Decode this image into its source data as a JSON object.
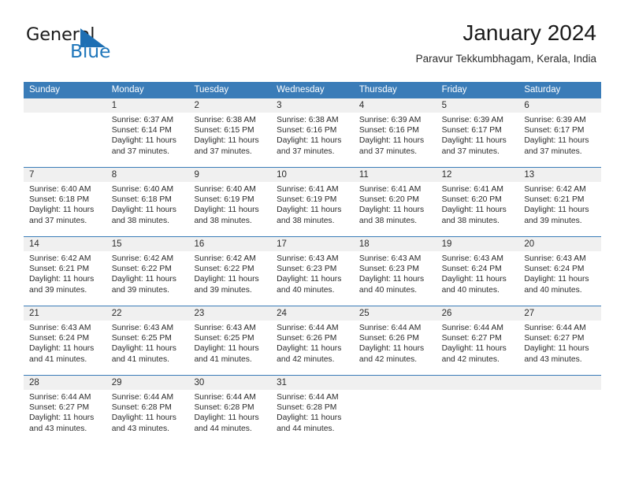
{
  "logo": {
    "word_one": "General",
    "word_two": "Blue",
    "triangle_icon": "triangle-icon",
    "blue_hex": "#2077BB"
  },
  "header": {
    "title": "January 2024",
    "subtitle": "Paravur Tekkumbhagam, Kerala, India"
  },
  "theme": {
    "header_blue": "#3A7CB8",
    "daynum_band": "#F0F0F0",
    "text": "#2B2B2B"
  },
  "calendar": {
    "weekdays": [
      "Sunday",
      "Monday",
      "Tuesday",
      "Wednesday",
      "Thursday",
      "Friday",
      "Saturday"
    ],
    "weeks": [
      [
        {
          "day": "",
          "sunrise": "",
          "sunset": "",
          "daylight1": "",
          "daylight2": ""
        },
        {
          "day": "1",
          "sunrise": "Sunrise: 6:37 AM",
          "sunset": "Sunset: 6:14 PM",
          "daylight1": "Daylight: 11 hours",
          "daylight2": "and 37 minutes."
        },
        {
          "day": "2",
          "sunrise": "Sunrise: 6:38 AM",
          "sunset": "Sunset: 6:15 PM",
          "daylight1": "Daylight: 11 hours",
          "daylight2": "and 37 minutes."
        },
        {
          "day": "3",
          "sunrise": "Sunrise: 6:38 AM",
          "sunset": "Sunset: 6:16 PM",
          "daylight1": "Daylight: 11 hours",
          "daylight2": "and 37 minutes."
        },
        {
          "day": "4",
          "sunrise": "Sunrise: 6:39 AM",
          "sunset": "Sunset: 6:16 PM",
          "daylight1": "Daylight: 11 hours",
          "daylight2": "and 37 minutes."
        },
        {
          "day": "5",
          "sunrise": "Sunrise: 6:39 AM",
          "sunset": "Sunset: 6:17 PM",
          "daylight1": "Daylight: 11 hours",
          "daylight2": "and 37 minutes."
        },
        {
          "day": "6",
          "sunrise": "Sunrise: 6:39 AM",
          "sunset": "Sunset: 6:17 PM",
          "daylight1": "Daylight: 11 hours",
          "daylight2": "and 37 minutes."
        }
      ],
      [
        {
          "day": "7",
          "sunrise": "Sunrise: 6:40 AM",
          "sunset": "Sunset: 6:18 PM",
          "daylight1": "Daylight: 11 hours",
          "daylight2": "and 37 minutes."
        },
        {
          "day": "8",
          "sunrise": "Sunrise: 6:40 AM",
          "sunset": "Sunset: 6:18 PM",
          "daylight1": "Daylight: 11 hours",
          "daylight2": "and 38 minutes."
        },
        {
          "day": "9",
          "sunrise": "Sunrise: 6:40 AM",
          "sunset": "Sunset: 6:19 PM",
          "daylight1": "Daylight: 11 hours",
          "daylight2": "and 38 minutes."
        },
        {
          "day": "10",
          "sunrise": "Sunrise: 6:41 AM",
          "sunset": "Sunset: 6:19 PM",
          "daylight1": "Daylight: 11 hours",
          "daylight2": "and 38 minutes."
        },
        {
          "day": "11",
          "sunrise": "Sunrise: 6:41 AM",
          "sunset": "Sunset: 6:20 PM",
          "daylight1": "Daylight: 11 hours",
          "daylight2": "and 38 minutes."
        },
        {
          "day": "12",
          "sunrise": "Sunrise: 6:41 AM",
          "sunset": "Sunset: 6:20 PM",
          "daylight1": "Daylight: 11 hours",
          "daylight2": "and 38 minutes."
        },
        {
          "day": "13",
          "sunrise": "Sunrise: 6:42 AM",
          "sunset": "Sunset: 6:21 PM",
          "daylight1": "Daylight: 11 hours",
          "daylight2": "and 39 minutes."
        }
      ],
      [
        {
          "day": "14",
          "sunrise": "Sunrise: 6:42 AM",
          "sunset": "Sunset: 6:21 PM",
          "daylight1": "Daylight: 11 hours",
          "daylight2": "and 39 minutes."
        },
        {
          "day": "15",
          "sunrise": "Sunrise: 6:42 AM",
          "sunset": "Sunset: 6:22 PM",
          "daylight1": "Daylight: 11 hours",
          "daylight2": "and 39 minutes."
        },
        {
          "day": "16",
          "sunrise": "Sunrise: 6:42 AM",
          "sunset": "Sunset: 6:22 PM",
          "daylight1": "Daylight: 11 hours",
          "daylight2": "and 39 minutes."
        },
        {
          "day": "17",
          "sunrise": "Sunrise: 6:43 AM",
          "sunset": "Sunset: 6:23 PM",
          "daylight1": "Daylight: 11 hours",
          "daylight2": "and 40 minutes."
        },
        {
          "day": "18",
          "sunrise": "Sunrise: 6:43 AM",
          "sunset": "Sunset: 6:23 PM",
          "daylight1": "Daylight: 11 hours",
          "daylight2": "and 40 minutes."
        },
        {
          "day": "19",
          "sunrise": "Sunrise: 6:43 AM",
          "sunset": "Sunset: 6:24 PM",
          "daylight1": "Daylight: 11 hours",
          "daylight2": "and 40 minutes."
        },
        {
          "day": "20",
          "sunrise": "Sunrise: 6:43 AM",
          "sunset": "Sunset: 6:24 PM",
          "daylight1": "Daylight: 11 hours",
          "daylight2": "and 40 minutes."
        }
      ],
      [
        {
          "day": "21",
          "sunrise": "Sunrise: 6:43 AM",
          "sunset": "Sunset: 6:24 PM",
          "daylight1": "Daylight: 11 hours",
          "daylight2": "and 41 minutes."
        },
        {
          "day": "22",
          "sunrise": "Sunrise: 6:43 AM",
          "sunset": "Sunset: 6:25 PM",
          "daylight1": "Daylight: 11 hours",
          "daylight2": "and 41 minutes."
        },
        {
          "day": "23",
          "sunrise": "Sunrise: 6:43 AM",
          "sunset": "Sunset: 6:25 PM",
          "daylight1": "Daylight: 11 hours",
          "daylight2": "and 41 minutes."
        },
        {
          "day": "24",
          "sunrise": "Sunrise: 6:44 AM",
          "sunset": "Sunset: 6:26 PM",
          "daylight1": "Daylight: 11 hours",
          "daylight2": "and 42 minutes."
        },
        {
          "day": "25",
          "sunrise": "Sunrise: 6:44 AM",
          "sunset": "Sunset: 6:26 PM",
          "daylight1": "Daylight: 11 hours",
          "daylight2": "and 42 minutes."
        },
        {
          "day": "26",
          "sunrise": "Sunrise: 6:44 AM",
          "sunset": "Sunset: 6:27 PM",
          "daylight1": "Daylight: 11 hours",
          "daylight2": "and 42 minutes."
        },
        {
          "day": "27",
          "sunrise": "Sunrise: 6:44 AM",
          "sunset": "Sunset: 6:27 PM",
          "daylight1": "Daylight: 11 hours",
          "daylight2": "and 43 minutes."
        }
      ],
      [
        {
          "day": "28",
          "sunrise": "Sunrise: 6:44 AM",
          "sunset": "Sunset: 6:27 PM",
          "daylight1": "Daylight: 11 hours",
          "daylight2": "and 43 minutes."
        },
        {
          "day": "29",
          "sunrise": "Sunrise: 6:44 AM",
          "sunset": "Sunset: 6:28 PM",
          "daylight1": "Daylight: 11 hours",
          "daylight2": "and 43 minutes."
        },
        {
          "day": "30",
          "sunrise": "Sunrise: 6:44 AM",
          "sunset": "Sunset: 6:28 PM",
          "daylight1": "Daylight: 11 hours",
          "daylight2": "and 44 minutes."
        },
        {
          "day": "31",
          "sunrise": "Sunrise: 6:44 AM",
          "sunset": "Sunset: 6:28 PM",
          "daylight1": "Daylight: 11 hours",
          "daylight2": "and 44 minutes."
        },
        {
          "day": "",
          "sunrise": "",
          "sunset": "",
          "daylight1": "",
          "daylight2": ""
        },
        {
          "day": "",
          "sunrise": "",
          "sunset": "",
          "daylight1": "",
          "daylight2": ""
        },
        {
          "day": "",
          "sunrise": "",
          "sunset": "",
          "daylight1": "",
          "daylight2": ""
        }
      ]
    ]
  }
}
